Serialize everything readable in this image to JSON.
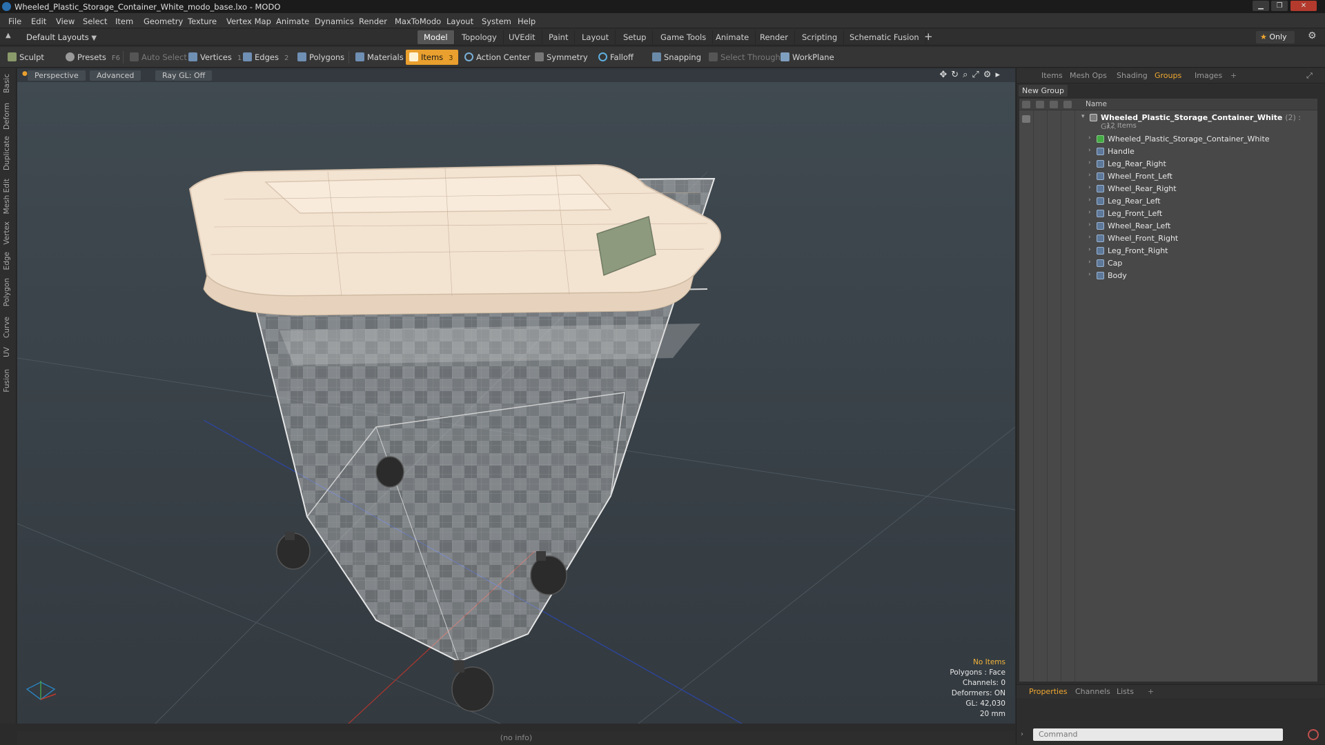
{
  "window": {
    "title": "Wheeled_Plastic_Storage_Container_White_modo_base.lxo - MODO",
    "min": "▁",
    "max": "❐",
    "close": "✕"
  },
  "menu": [
    "File",
    "Edit",
    "View",
    "Select",
    "Item",
    "Geometry",
    "Texture",
    "Vertex Map",
    "Animate",
    "Dynamics",
    "Render",
    "MaxToModo",
    "Layout",
    "System",
    "Help"
  ],
  "layouts": {
    "label": "Default Layouts"
  },
  "layout_tabs": [
    "Model",
    "Topology",
    "UVEdit",
    "Paint",
    "Layout",
    "Setup",
    "Game Tools",
    "Animate",
    "Render",
    "Scripting",
    "Schematic Fusion"
  ],
  "active_layout_tab": "Model",
  "add_tab": "+",
  "only_label": "Only",
  "toolbar": {
    "sculpt": "Sculpt",
    "presets": "Presets",
    "presets_key": "F6",
    "auto_select": "Auto Select",
    "vertices": "Vertices",
    "vertices_count": "1",
    "edges": "Edges",
    "edges_count": "2",
    "polygons": "Polygons",
    "materials": "Materials",
    "items": "Items",
    "items_count": "3",
    "action_center": "Action Center",
    "symmetry": "Symmetry",
    "falloff": "Falloff",
    "snapping": "Snapping",
    "select_through": "Select Through",
    "workplane": "WorkPlane"
  },
  "left_tabs": [
    "Basic",
    "Deform",
    "Duplicate",
    "Mesh Edit",
    "Vertex",
    "Edge",
    "Polygon",
    "Curve",
    "UV",
    "Fusion"
  ],
  "viewport": {
    "view": "Perspective",
    "shading": "Advanced",
    "raygl": "Ray GL: Off",
    "info": {
      "selection": "No Items",
      "polygons": "Polygons : Face",
      "channels": "Channels: 0",
      "deformers": "Deformers: ON",
      "gl": "GL: 42,030",
      "unit": "20 mm"
    }
  },
  "right_panel": {
    "tabs": [
      "Items",
      "Mesh Ops",
      "Shading",
      "Groups",
      "Images"
    ],
    "active_tab": "Groups",
    "new_group": "New Group",
    "name_col": "Name",
    "root": {
      "name": "Wheeled_Plastic_Storage_Container_White",
      "suffix": "(2) : Gr...",
      "count": "12 Items"
    },
    "items": [
      "Wheeled_Plastic_Storage_Container_White",
      "Handle",
      "Leg_Rear_Right",
      "Wheel_Front_Left",
      "Wheel_Rear_Right",
      "Leg_Rear_Left",
      "Leg_Front_Left",
      "Wheel_Rear_Left",
      "Wheel_Front_Right",
      "Leg_Front_Right",
      "Cap",
      "Body"
    ],
    "bottom_tabs": [
      "Properties",
      "Channels",
      "Lists"
    ],
    "active_bottom_tab": "Properties",
    "command_placeholder": "Command"
  },
  "status": "(no info)",
  "colors": {
    "accent": "#e9a02e",
    "viewport_bg": "#394046",
    "lid": "#f4e4d2",
    "handle": "#8d9a7e"
  }
}
